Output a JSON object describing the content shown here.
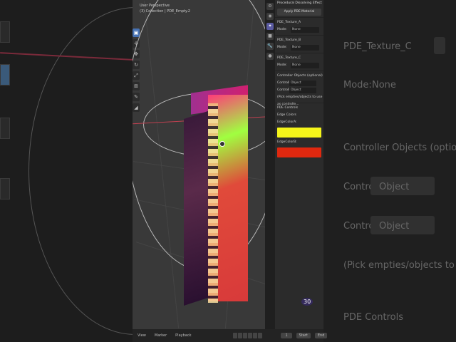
{
  "viewport": {
    "view_name": "User Perspective",
    "collection_path": "(3) Collection | PDE_Empty.2"
  },
  "toolbar": {
    "tools": [
      "select-icon",
      "cursor-icon",
      "move-icon",
      "rotate-icon",
      "scale-icon",
      "transform-icon",
      "annotate-icon",
      "measure-icon"
    ]
  },
  "panel": {
    "section_title": "Procedural Dissolving Effect",
    "apply_button": "Apply PDE Material",
    "textures": [
      {
        "name": "PDE_Texture_A",
        "mode_label": "Mode:",
        "mode_value": "None"
      },
      {
        "name": "PDE_Texture_B",
        "mode_label": "Mode:",
        "mode_value": "None"
      },
      {
        "name": "PDE_Texture_C",
        "mode_label": "Mode:",
        "mode_value": "None"
      }
    ],
    "controllers_title": "Controller Objects (optional)",
    "controllers": [
      {
        "label": "Controll...",
        "placeholder": "Object"
      },
      {
        "label": "Controll...",
        "placeholder": "Object"
      }
    ],
    "hint": "(Pick empties/objects to use as controlle...",
    "controls_title": "PDE Controls",
    "edge_colors_label": "Edge Colors",
    "edge_a_label": "EdgeColorA:",
    "edge_a_color": "#f5f51a",
    "edge_b_label": "EdgeColorB:",
    "edge_b_color": "#e0280f"
  },
  "timeline": {
    "view": "View",
    "marker": "Marker",
    "playback": "Playback",
    "current_frame": "1",
    "start_label": "Start",
    "end_label": "End"
  },
  "cursor_badge": "30",
  "bg_right": {
    "texture_name": "PDE_Texture_C",
    "mode_label": "Mode:",
    "mode_value": "None",
    "controllers_title": "Controller Objects (optional)",
    "controller_label": "Controll...",
    "object_placeholder": "Object",
    "hint": "(Pick empties/objects to use as controlle...",
    "controls_title": "PDE Controls"
  }
}
